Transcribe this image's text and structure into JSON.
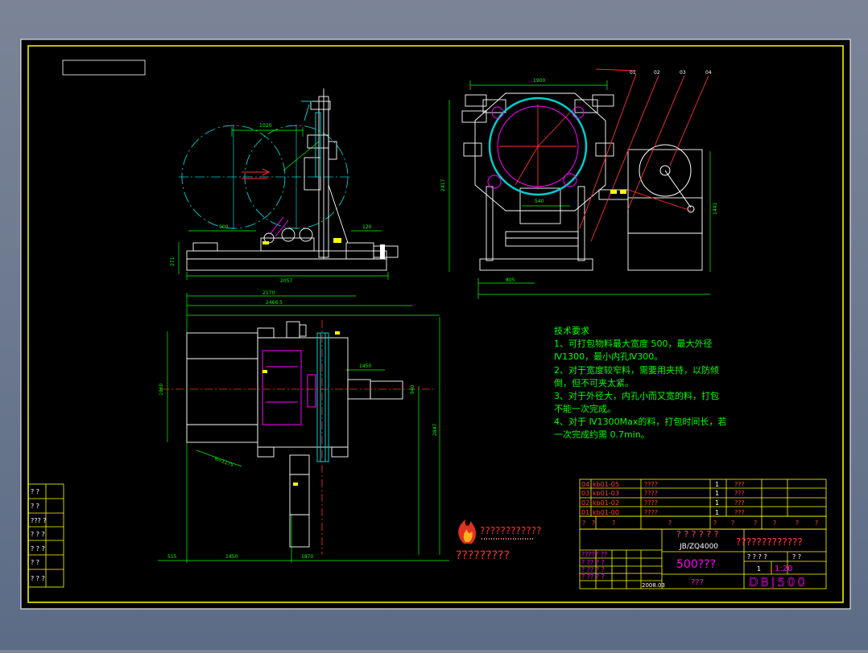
{
  "colors": {
    "background": "#6f7b90",
    "sheet": "#000000",
    "frame": "#ffff00",
    "outline": "#ffffff",
    "dimension": "#00ff00",
    "centerline": "#ff0000",
    "circle": "#00cccc",
    "accent": "#ff00ff",
    "table_text": "#ff4040"
  },
  "dimensions": {
    "top_left": [
      "1020",
      "900",
      "120",
      "2057",
      "271"
    ],
    "top_right": [
      "1900",
      "2417",
      "540",
      "805",
      "1441"
    ],
    "plan": [
      "2170",
      "2466.5",
      "1450",
      "1960",
      "2847",
      "940",
      "515",
      "1870",
      "1450",
      "R=1175"
    ]
  },
  "balloons": [
    "01",
    "02",
    "03",
    "04"
  ],
  "notes": {
    "title": "技术要求",
    "lines": [
      "1、可打包物料最大宽度 500，最大外径",
      "Ⅳ1300，最小内孔Ⅳ300。",
      "2、对于宽度较窄料，需要用夹持，以防倾",
      "倒，但不可夹太紧。",
      "3、对于外径大，内孔小而又宽的料，打包",
      "不能一次完成。",
      "4、对于 Ⅳ1300Max的料，打包时间长，若",
      "一次完成约需 0.7min。"
    ]
  },
  "parts": [
    {
      "no": "04",
      "code": "kb01-05",
      "name": "????",
      "qty": "1",
      "mat": "???"
    },
    {
      "no": "03",
      "code": "kb01-03",
      "name": "????",
      "qty": "1",
      "mat": "???"
    },
    {
      "no": "02",
      "code": "kb01-02",
      "name": "????",
      "qty": "1",
      "mat": "???"
    },
    {
      "no": "01",
      "code": "kb01-00",
      "name": "????",
      "qty": "1",
      "mat": "???"
    }
  ],
  "header_row": [
    "?",
    "?",
    "?",
    "?",
    "?",
    "?",
    "?",
    "?",
    "?",
    "?"
  ],
  "title_block": {
    "title_q": "? ? ? ? ? ?",
    "standard": "JB/ZQ4000",
    "company_q": "?????????????",
    "product": "500???",
    "scale_q": "???",
    "drawing_no": "DBJ500",
    "date": "2008.03",
    "row_labels": [
      "?",
      "?",
      "???",
      "? ?",
      "? ?"
    ],
    "qs": "? ? ? ?",
    "small_a": "? ?",
    "small_b": "1",
    "small_c": "1:20",
    "left_stack": [
      "????? ??",
      "? ?? ? ?",
      "? ?? ? ?",
      "? ?? ? ?"
    ]
  },
  "logo": {
    "line1": "????????????",
    "line2": "?????????"
  },
  "left_strip": [
    "? ?",
    "? ?",
    "??? ?",
    "? ? ?",
    "? ? ?",
    "? ?",
    "? ? ?"
  ]
}
